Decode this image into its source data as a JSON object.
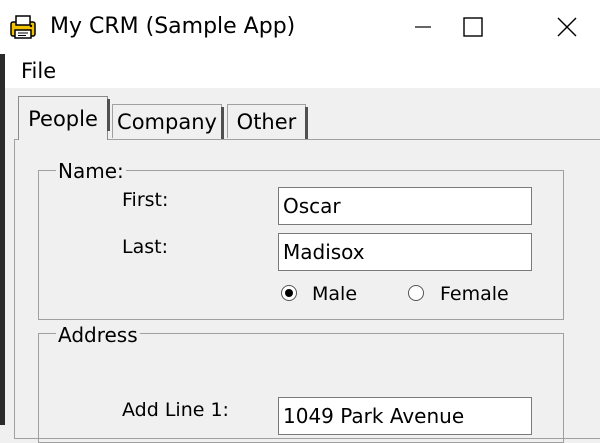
{
  "window": {
    "title": "My CRM (Sample App)",
    "icons": {
      "app": "printer-app-icon",
      "minimize": "minimize-icon",
      "maximize": "maximize-icon",
      "close": "close-icon"
    }
  },
  "menu": {
    "file": "File"
  },
  "tabs": [
    "People",
    "Company",
    "Other"
  ],
  "active_tab": "People",
  "people": {
    "name_group": {
      "legend": "Name:",
      "first_label": "First:",
      "first_value": "Oscar",
      "last_label": "Last:",
      "last_value": "Madisox",
      "gender": {
        "male": "Male",
        "female": "Female",
        "selected": "Male"
      }
    },
    "address_group": {
      "legend": "Address",
      "line1_label": "Add Line 1:",
      "line1_value": "1049 Park Avenue"
    }
  }
}
